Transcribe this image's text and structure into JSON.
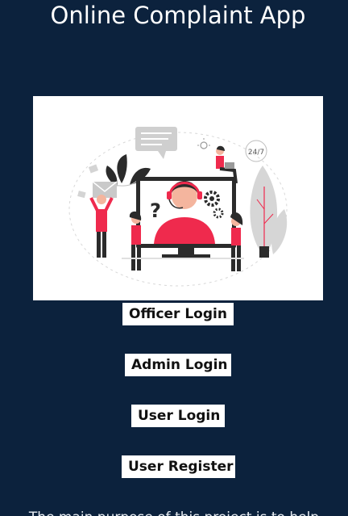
{
  "app": {
    "title": "Online Complaint App"
  },
  "hero": {
    "illustration": "customer-support-illustration",
    "badge_text": "24/7",
    "colors": {
      "accent": "#ef2a4d",
      "dark": "#2b2b2b",
      "gray": "#c9c9c9"
    }
  },
  "buttons": {
    "officer_login": "Officer Login",
    "admin_login": "Admin Login",
    "user_login": "User Login",
    "user_register": "User Register"
  },
  "footer": {
    "description": "The main purpose of this project is to help"
  },
  "colors": {
    "background": "#0c223d",
    "button_bg": "#ffffff",
    "title_text": "#ffffff"
  }
}
